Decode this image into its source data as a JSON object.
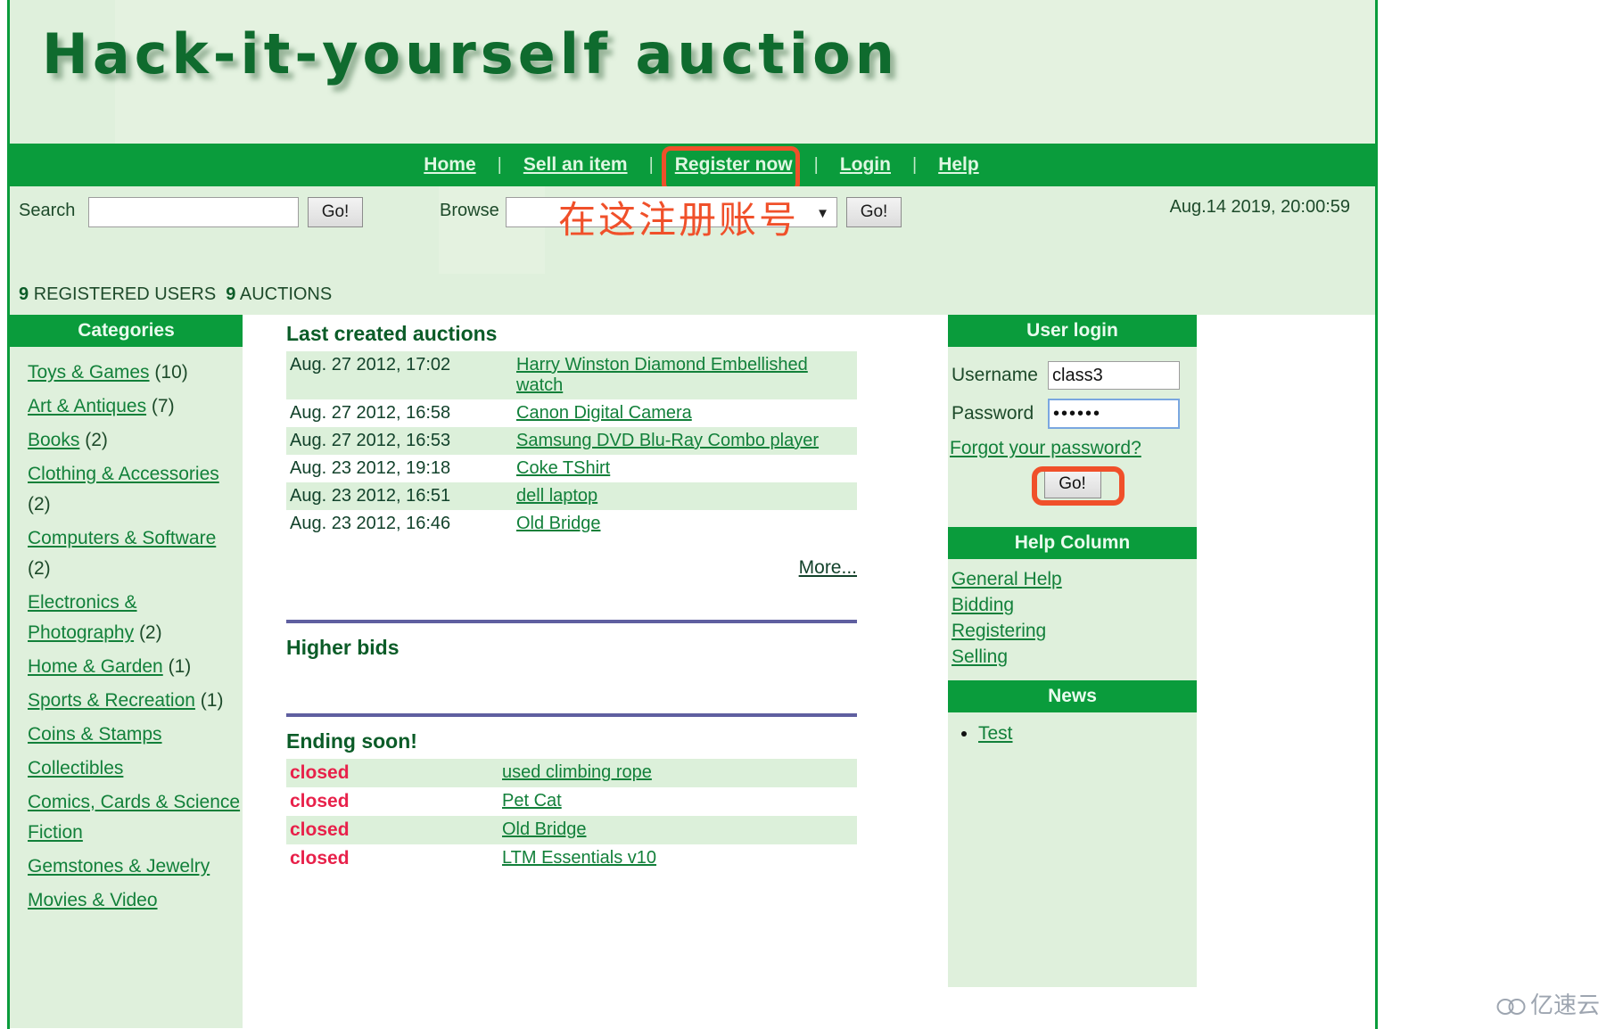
{
  "site": {
    "banner_title": "Hack-it-yourself auction"
  },
  "nav": {
    "items": [
      {
        "label": "Home"
      },
      {
        "label": "Sell an item"
      },
      {
        "label": "Register now"
      },
      {
        "label": "Login"
      },
      {
        "label": "Help"
      }
    ],
    "separator": "|"
  },
  "toolbar": {
    "search_label": "Search",
    "search_value": "",
    "search_placeholder": "",
    "search_go_label": "Go!",
    "browse_label": "Browse",
    "browse_selected": "",
    "browse_go_label": "Go!",
    "dropdown_arrow": "▼",
    "timestamp": "Aug.14 2019, 20:00:59"
  },
  "annotations": {
    "register_hint": "在这注册账号",
    "highlight_color": "#f0502a"
  },
  "stats": {
    "users_count": "9",
    "users_label": "REGISTERED USERS",
    "auctions_count": "9",
    "auctions_label": "AUCTIONS"
  },
  "categories": {
    "heading": "Categories",
    "items": [
      {
        "label": "Toys & Games",
        "count": "(10)"
      },
      {
        "label": "Art & Antiques",
        "count": "(7)"
      },
      {
        "label": "Books",
        "count": "(2)"
      },
      {
        "label": "Clothing & Accessories",
        "count": "(2)"
      },
      {
        "label": "Computers & Software",
        "count": "(2)"
      },
      {
        "label": "Electronics & Photography",
        "count": "(2)"
      },
      {
        "label": "Home & Garden",
        "count": "(1)"
      },
      {
        "label": "Sports & Recreation",
        "count": "(1)"
      },
      {
        "label": "Coins & Stamps",
        "count": ""
      },
      {
        "label": "Collectibles",
        "count": ""
      },
      {
        "label": "Comics, Cards & Science Fiction",
        "count": ""
      },
      {
        "label": "Gemstones & Jewelry",
        "count": ""
      },
      {
        "label": "Movies & Video",
        "count": ""
      }
    ]
  },
  "last_created": {
    "heading": "Last created auctions",
    "rows": [
      {
        "date": "Aug. 27 2012, 17:02",
        "title": "Harry Winston Diamond Embellished watch"
      },
      {
        "date": "Aug. 27 2012, 16:58",
        "title": "Canon Digital Camera"
      },
      {
        "date": "Aug. 27 2012, 16:53",
        "title": "Samsung DVD Blu-Ray Combo player"
      },
      {
        "date": "Aug. 23 2012, 19:18",
        "title": "Coke TShirt"
      },
      {
        "date": "Aug. 23 2012, 16:51",
        "title": "dell laptop"
      },
      {
        "date": "Aug. 23 2012, 16:46",
        "title": "Old Bridge"
      }
    ],
    "more_label": "More..."
  },
  "higher_bids": {
    "heading": "Higher bids",
    "rows": []
  },
  "ending_soon": {
    "heading": "Ending soon!",
    "rows": [
      {
        "status": "closed",
        "title": "used climbing rope"
      },
      {
        "status": "closed",
        "title": "Pet Cat"
      },
      {
        "status": "closed",
        "title": "Old Bridge"
      },
      {
        "status": "closed",
        "title": "LTM Essentials v10"
      }
    ]
  },
  "user_login": {
    "heading": "User login",
    "username_label": "Username",
    "username_value": "class3",
    "password_label": "Password",
    "password_value": "••••••",
    "forgot_label": "Forgot your password?",
    "go_label": "Go!"
  },
  "help_column": {
    "heading": "Help Column",
    "items": [
      {
        "label": "General Help"
      },
      {
        "label": "Bidding"
      },
      {
        "label": "Registering"
      },
      {
        "label": "Selling"
      }
    ]
  },
  "news": {
    "heading": "News",
    "items": [
      {
        "label": "Test"
      }
    ]
  },
  "watermark": {
    "text": "亿速云"
  }
}
